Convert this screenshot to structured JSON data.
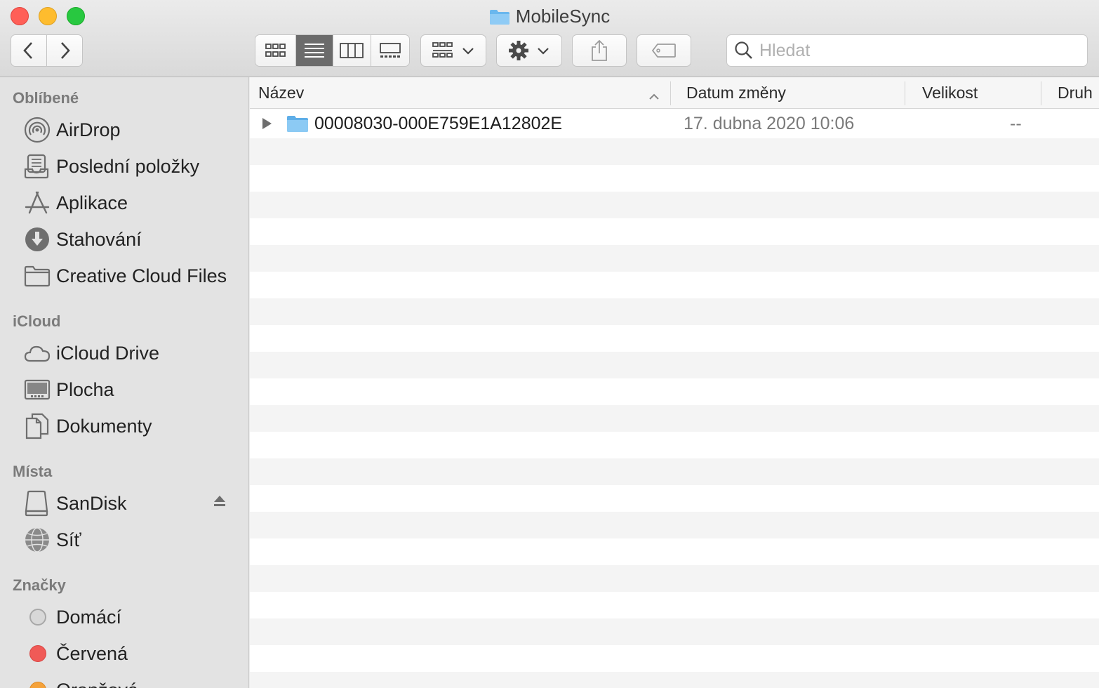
{
  "window": {
    "title": "MobileSync"
  },
  "toolbar": {
    "back": "back",
    "forward": "forward",
    "search_placeholder": "Hledat"
  },
  "sidebar": {
    "sections": [
      {
        "title": "Oblíbené"
      },
      {
        "title": "iCloud"
      },
      {
        "title": "Místa"
      },
      {
        "title": "Značky"
      }
    ],
    "favorites": [
      {
        "label": "AirDrop",
        "icon": "airdrop-icon"
      },
      {
        "label": "Poslední položky",
        "icon": "recents-icon"
      },
      {
        "label": "Aplikace",
        "icon": "applications-icon"
      },
      {
        "label": "Stahování",
        "icon": "downloads-icon"
      },
      {
        "label": "Creative Cloud Files",
        "icon": "folder-icon"
      }
    ],
    "icloud": [
      {
        "label": "iCloud Drive",
        "icon": "cloud-icon"
      },
      {
        "label": "Plocha",
        "icon": "desktop-icon"
      },
      {
        "label": "Dokumenty",
        "icon": "documents-icon"
      }
    ],
    "locations": [
      {
        "label": "SanDisk",
        "icon": "drive-icon"
      },
      {
        "label": "Síť",
        "icon": "network-icon"
      }
    ],
    "tags": [
      {
        "label": "Domácí",
        "color": "#d8d8d8"
      },
      {
        "label": "Červená",
        "color": "#f05a57"
      },
      {
        "label": "Oranžová",
        "color": "#f5a23a"
      }
    ]
  },
  "list": {
    "columns": {
      "name": "Název",
      "date": "Datum změny",
      "size": "Velikost",
      "kind": "Druh"
    },
    "rows": [
      {
        "name": "00008030-000E759E1A12802E",
        "date": "17. dubna 2020 10:06",
        "size": "--",
        "kind": ""
      }
    ]
  },
  "colors": {
    "folder_blue": "#6ab7ee",
    "accent": "#6b6b6b"
  }
}
